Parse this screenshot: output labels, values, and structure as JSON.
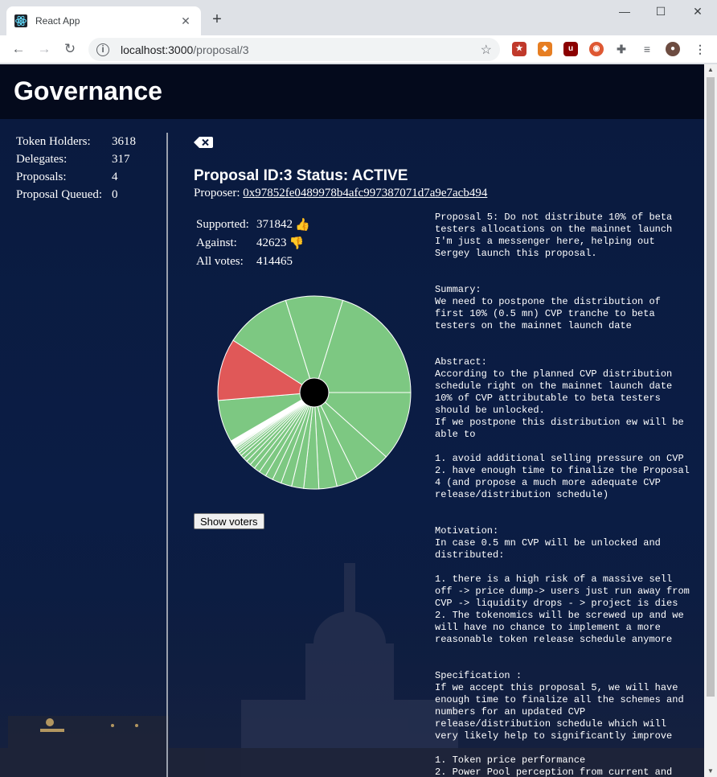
{
  "browser": {
    "tab_title": "React App",
    "url_host": "localhost:3000",
    "url_path": "/proposal/3"
  },
  "app": {
    "title": "Governance"
  },
  "stats": [
    {
      "label": "Token Holders:",
      "value": "3618"
    },
    {
      "label": "Delegates:",
      "value": "317"
    },
    {
      "label": "Proposals:",
      "value": "4"
    },
    {
      "label": "Proposal Queued:",
      "value": "0"
    }
  ],
  "proposal": {
    "title": "Proposal ID:3  Status: ACTIVE",
    "proposer_label": "Proposer:",
    "proposer_address": "0x97852fe0489978b4afc997387071d7a9e7acb494",
    "supported_label": "Supported:",
    "supported_value": "371842",
    "against_label": "Against:",
    "against_value": "42623",
    "all_label": "All votes:",
    "all_value": "414465",
    "show_voters_label": "Show voters",
    "description": "Proposal 5: Do not distribute 10% of beta\ntesters allocations on the mainnet launch\nI'm just a messenger here, helping out\nSergey launch this proposal.\n\n\nSummary:\nWe need to postpone the distribution of\nfirst 10% (0.5 mn) CVP tranche to beta\ntesters on the mainnet launch date\n\n\nAbstract:\nAccording to the planned CVP distribution\nschedule right on the mainnet launch date\n10% of CVP attributable to beta testers\nshould be unlocked.\nIf we postpone this distribution ew will be\nable to\n\n1. avoid additional selling pressure on CVP\n2. have enough time to finalize the Proposal\n4 (and propose a much more adequate CVP\nrelease/distribution schedule)\n\n\nMotivation:\nIn case 0.5 mn CVP will be unlocked and\ndistributed:\n\n1. there is a high risk of a massive sell\noff -> price dump-> users just run away from\nCVP -> liquidity drops - > project is dies\n2. The tokenomics will be screwed up and we\nwill have no chance to implement a more\nreasonable token release schedule anymore\n\n\nSpecification :\nIf we accept this proposal 5, we will have\nenough time to finalize all the schemes and\nnumbers for an updated CVP\nrelease/distribution schedule which will\nvery likely help to significantly improve\n\n1. Token price performance\n2. Power Pool perception from current and"
  },
  "chart_data": {
    "type": "pie",
    "slices": [
      {
        "value": 11.5,
        "color": "#7dc882"
      },
      {
        "value": 6.0,
        "color": "#7dc882"
      },
      {
        "value": 3.5,
        "color": "#7dc882"
      },
      {
        "value": 3.0,
        "color": "#7dc882"
      },
      {
        "value": 2.5,
        "color": "#7dc882"
      },
      {
        "value": 2.0,
        "color": "#7dc882"
      },
      {
        "value": 1.8,
        "color": "#7dc882"
      },
      {
        "value": 1.5,
        "color": "#7dc882"
      },
      {
        "value": 1.3,
        "color": "#7dc882"
      },
      {
        "value": 1.2,
        "color": "#7dc882"
      },
      {
        "value": 1.0,
        "color": "#7dc882"
      },
      {
        "value": 0.9,
        "color": "#7dc882"
      },
      {
        "value": 0.8,
        "color": "#7dc882"
      },
      {
        "value": 0.7,
        "color": "#7dc882"
      },
      {
        "value": 0.6,
        "color": "#7dc882"
      },
      {
        "value": 0.5,
        "color": "#7dc882"
      },
      {
        "value": 0.4,
        "color": "#7dc882"
      },
      {
        "value": 0.3,
        "color": "#7dc882"
      },
      {
        "value": 0.3,
        "color": "#7dc882"
      },
      {
        "value": 0.2,
        "color": "#7dc882"
      },
      {
        "value": 0.2,
        "color": "#7dc882"
      },
      {
        "value": 0.1,
        "color": "#7dc882"
      },
      {
        "value": 0.1,
        "color": "#7dc882"
      },
      {
        "value": 0.1,
        "color": "#7dc882"
      },
      {
        "value": 0.1,
        "color": "#7dc882"
      },
      {
        "value": 0.1,
        "color": "#7dc882"
      },
      {
        "value": 0.1,
        "color": "#7dc882"
      },
      {
        "value": 0.1,
        "color": "#7dc882"
      },
      {
        "value": 0.1,
        "color": "#7dc882"
      },
      {
        "value": 0.1,
        "color": "#7dc882"
      },
      {
        "value": 0.1,
        "color": "#7dc882"
      },
      {
        "value": 7.0,
        "color": "#7dc882"
      },
      {
        "value": 10.3,
        "color": "#e05858"
      },
      {
        "value": 11.0,
        "color": "#7dc882"
      },
      {
        "value": 9.5,
        "color": "#7dc882"
      },
      {
        "value": 20.0,
        "color": "#7dc882"
      }
    ]
  },
  "colors": {
    "supported": "#7dc882",
    "against": "#e05858"
  }
}
